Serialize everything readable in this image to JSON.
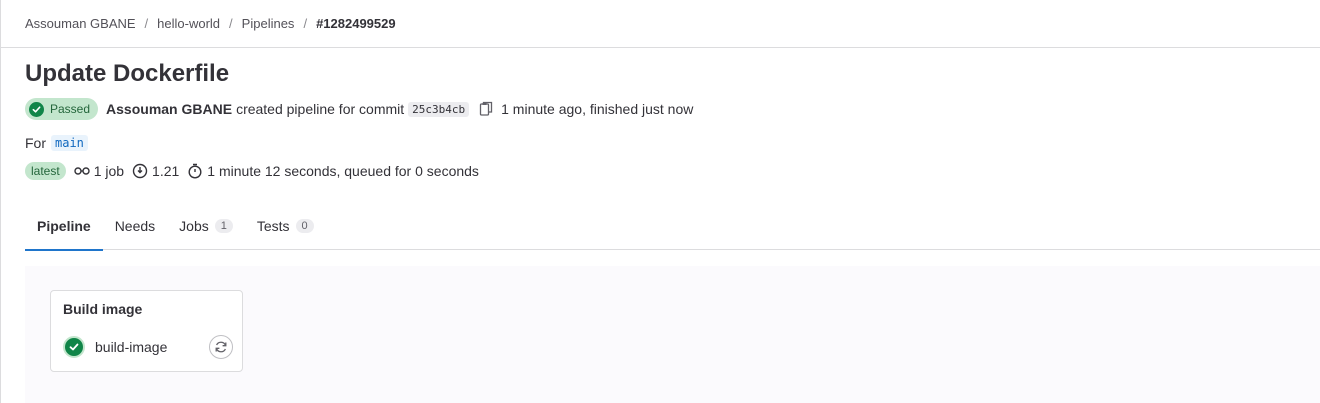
{
  "breadcrumb": {
    "items": [
      "Assouman GBANE",
      "hello-world",
      "Pipelines"
    ],
    "current": "#1282499529",
    "separator": "/"
  },
  "page_title": "Update Dockerfile",
  "status": {
    "label": "Passed",
    "author": "Assouman GBANE",
    "action_text": "created pipeline for commit",
    "commit_sha": "25c3b4cb",
    "time_text": "1 minute ago, finished just now"
  },
  "ref": {
    "label": "For",
    "branch": "main"
  },
  "meta": {
    "latest_badge": "latest",
    "jobs": "1 job",
    "duration_badge": "1.21",
    "timing": "1 minute 12 seconds, queued for 0 seconds"
  },
  "tabs": [
    {
      "label": "Pipeline"
    },
    {
      "label": "Needs"
    },
    {
      "label": "Jobs",
      "count": "1"
    },
    {
      "label": "Tests",
      "count": "0"
    }
  ],
  "stage": {
    "title": "Build image",
    "job_name": "build-image"
  },
  "colors": {
    "success": "#108548",
    "success_bg": "#c3e6cd",
    "link": "#1068bf",
    "active_tab": "#1f75cb"
  },
  "icons": {
    "copy": "copy-icon",
    "pipeline": "pipeline-icon",
    "clock_dollar": "compute-icon",
    "timer": "timer-icon",
    "retry": "retry-icon",
    "check": "check-icon"
  }
}
